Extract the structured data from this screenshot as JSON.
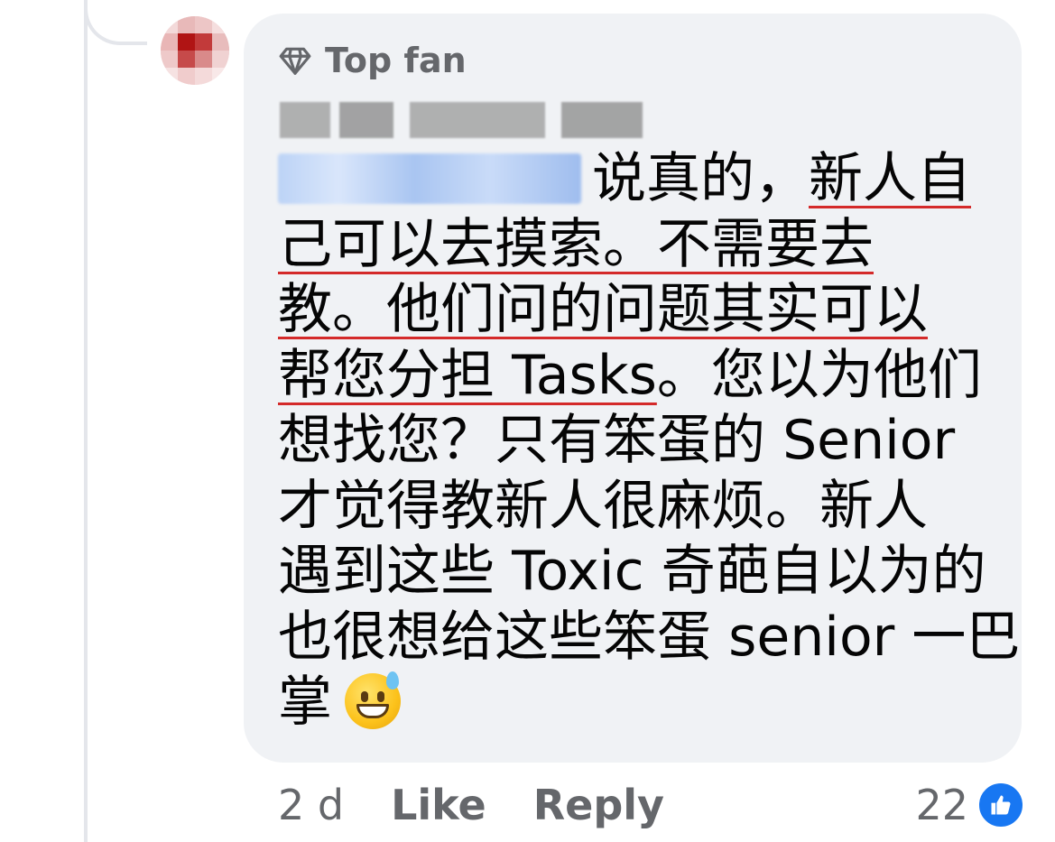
{
  "comment": {
    "badge_label": "Top fan",
    "body_lines": [
      {
        "after_tag": "说真的，",
        "ul": "新人自"
      },
      {
        "ul": "己可以去摸索。不需要去"
      },
      {
        "ul": "教。他们问的问题其实可以"
      },
      {
        "ul": "帮您分担 Tasks",
        "rest": "。您以为他们"
      },
      {
        "rest": "想找您？只有笨蛋的 Senior"
      },
      {
        "rest": "才觉得教新人很麻烦。新人"
      },
      {
        "rest": "遇到这些 Toxic 奇葩自以为的"
      },
      {
        "rest": "也很想给这些笨蛋 senior 一巴"
      },
      {
        "rest": "掌"
      }
    ],
    "emoji": "grinning-face-with-sweat"
  },
  "footer": {
    "timestamp": "2 d",
    "like_label": "Like",
    "reply_label": "Reply",
    "reaction_count": "22"
  },
  "colors": {
    "bubble": "#f0f2f5",
    "secondary_text": "#65676b",
    "like_blue": "#1877f2",
    "underline_red": "#d42a2a"
  }
}
